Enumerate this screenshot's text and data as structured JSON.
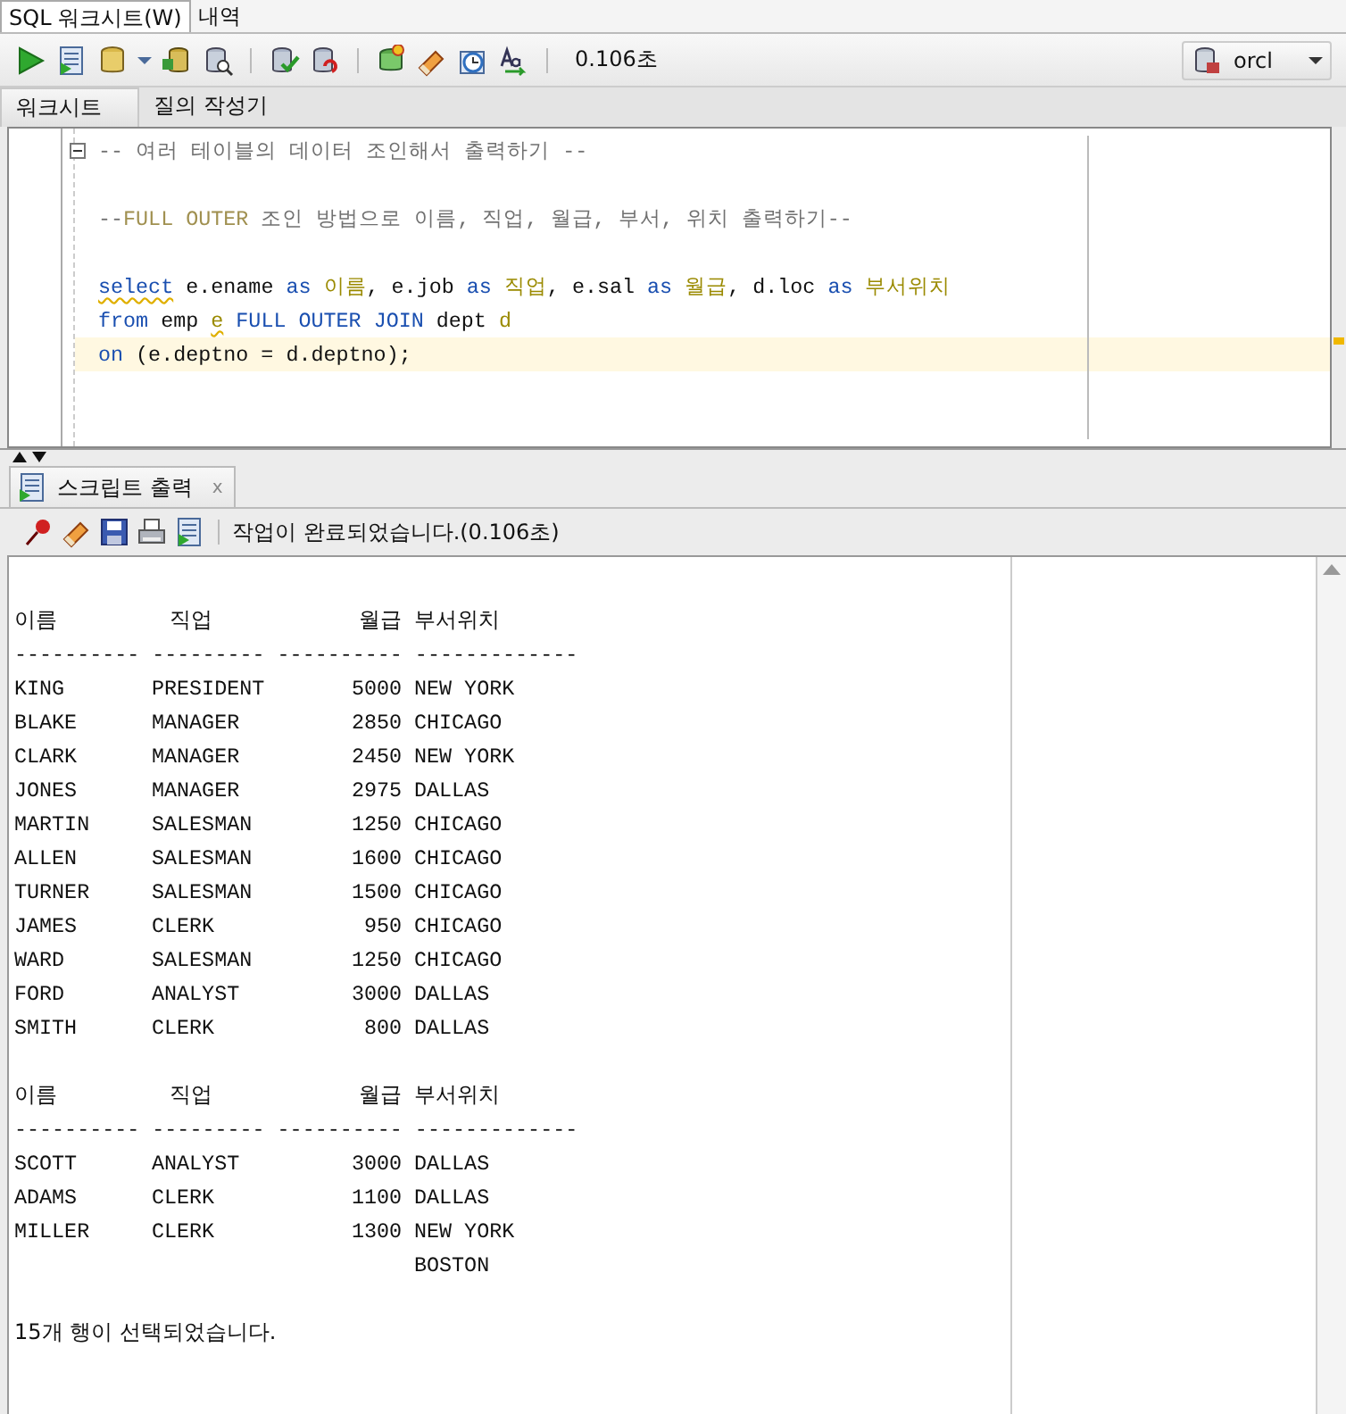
{
  "menu_tabs": [
    {
      "label": "SQL 워크시트(W)",
      "selected": true
    },
    {
      "label": "내역",
      "selected": false
    }
  ],
  "toolbar": {
    "elapsed": "0.106초",
    "connection": "orcl"
  },
  "editor_tabs": [
    {
      "label": "워크시트",
      "selected": true
    },
    {
      "label": "질의 작성기",
      "selected": false
    }
  ],
  "code_lines": [
    {
      "current": false,
      "fold": true,
      "tokens": [
        {
          "kind": "comment",
          "text": "-- 여러 테이블의 데이터 조인해서 출력하기 --"
        }
      ]
    },
    {
      "current": false
    },
    {
      "current": false,
      "tokens": [
        {
          "kind": "comment",
          "text": "--"
        },
        {
          "kind": "comment_kw",
          "text": "FULL OUTER"
        },
        {
          "kind": "comment",
          "text": " 조인 방법으로 이름, 직업, 월급, 부서, 위치 출력하기--"
        }
      ]
    },
    {
      "current": false
    },
    {
      "current": false,
      "tokens": [
        {
          "kind": "kw",
          "text": "select",
          "flagged": true
        },
        {
          "kind": "id",
          "text": " e.ename "
        },
        {
          "kind": "kw",
          "text": "as"
        },
        {
          "kind": "alias",
          "text": " 이름"
        },
        {
          "kind": "id",
          "text": ", e.job "
        },
        {
          "kind": "kw",
          "text": "as"
        },
        {
          "kind": "alias",
          "text": " 직업"
        },
        {
          "kind": "id",
          "text": ", e.sal "
        },
        {
          "kind": "kw",
          "text": "as"
        },
        {
          "kind": "alias",
          "text": " 월급"
        },
        {
          "kind": "id",
          "text": ", d.loc "
        },
        {
          "kind": "kw",
          "text": "as"
        },
        {
          "kind": "alias",
          "text": " 부서위치"
        }
      ]
    },
    {
      "current": false,
      "tokens": [
        {
          "kind": "kw",
          "text": "from"
        },
        {
          "kind": "id",
          "text": " emp "
        },
        {
          "kind": "alias",
          "text": "e",
          "flagged": true
        },
        {
          "kind": "kw",
          "text": " FULL OUTER JOIN"
        },
        {
          "kind": "id",
          "text": " dept "
        },
        {
          "kind": "alias",
          "text": "d"
        }
      ]
    },
    {
      "current": true,
      "tokens": [
        {
          "kind": "kw",
          "text": "on"
        },
        {
          "kind": "id",
          "text": " (e.deptno = d.deptno);"
        }
      ]
    }
  ],
  "output_tab": {
    "label": "스크립트 출력",
    "close": "x"
  },
  "output_status": "작업이 완료되었습니다.(0.106초)",
  "result_blocks": [
    {
      "headers": [
        "이름",
        "직업",
        "월급",
        "부서위치"
      ],
      "rule": "---------- --------- ---------- -------------",
      "rows": [
        {
          "ename": "KING",
          "job": "PRESIDENT",
          "sal": "5000",
          "loc": "NEW YORK"
        },
        {
          "ename": "BLAKE",
          "job": "MANAGER",
          "sal": "2850",
          "loc": "CHICAGO"
        },
        {
          "ename": "CLARK",
          "job": "MANAGER",
          "sal": "2450",
          "loc": "NEW YORK"
        },
        {
          "ename": "JONES",
          "job": "MANAGER",
          "sal": "2975",
          "loc": "DALLAS"
        },
        {
          "ename": "MARTIN",
          "job": "SALESMAN",
          "sal": "1250",
          "loc": "CHICAGO"
        },
        {
          "ename": "ALLEN",
          "job": "SALESMAN",
          "sal": "1600",
          "loc": "CHICAGO"
        },
        {
          "ename": "TURNER",
          "job": "SALESMAN",
          "sal": "1500",
          "loc": "CHICAGO"
        },
        {
          "ename": "JAMES",
          "job": "CLERK",
          "sal": "950",
          "loc": "CHICAGO"
        },
        {
          "ename": "WARD",
          "job": "SALESMAN",
          "sal": "1250",
          "loc": "CHICAGO"
        },
        {
          "ename": "FORD",
          "job": "ANALYST",
          "sal": "3000",
          "loc": "DALLAS"
        },
        {
          "ename": "SMITH",
          "job": "CLERK",
          "sal": "800",
          "loc": "DALLAS"
        }
      ]
    },
    {
      "headers": [
        "이름",
        "직업",
        "월급",
        "부서위치"
      ],
      "rule": "---------- --------- ---------- -------------",
      "rows": [
        {
          "ename": "SCOTT",
          "job": "ANALYST",
          "sal": "3000",
          "loc": "DALLAS"
        },
        {
          "ename": "ADAMS",
          "job": "CLERK",
          "sal": "1100",
          "loc": "DALLAS"
        },
        {
          "ename": "MILLER",
          "job": "CLERK",
          "sal": "1300",
          "loc": "NEW YORK"
        },
        {
          "loc": "BOSTON"
        }
      ]
    }
  ],
  "result_message": "15개 행이 선택되었습니다."
}
